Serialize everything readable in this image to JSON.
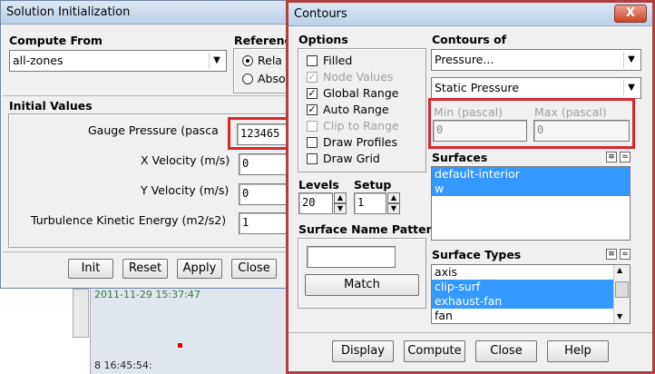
{
  "background": {
    "timestamp1": "2011-11-29 15:37:47",
    "timestamp2": "8 16:45:54:"
  },
  "solution_init": {
    "title": "Solution Initialization",
    "compute_from_label": "Compute From",
    "compute_from_value": "all-zones",
    "reference_label": "Referenc",
    "radio_relative": "Rela",
    "radio_absolute": "Abso",
    "initial_values_label": "Initial Values",
    "fields": [
      {
        "label": "Gauge Pressure (pasca",
        "value": "123465"
      },
      {
        "label": "X Velocity (m/s)",
        "value": "0"
      },
      {
        "label": "Y Velocity (m/s)",
        "value": "0"
      },
      {
        "label": "Turbulence Kinetic Energy (m2/s2)",
        "value": "1"
      }
    ],
    "buttons": {
      "init": "Init",
      "reset": "Reset",
      "apply": "Apply",
      "close": "Close"
    }
  },
  "contours": {
    "title": "Contours",
    "close_symbol": "X",
    "options_label": "Options",
    "options": [
      {
        "label": "Filled",
        "checked": false,
        "disabled": false
      },
      {
        "label": "Node Values",
        "checked": true,
        "disabled": true
      },
      {
        "label": "Global Range",
        "checked": true,
        "disabled": false
      },
      {
        "label": "Auto Range",
        "checked": true,
        "disabled": false
      },
      {
        "label": "Clip to Range",
        "checked": false,
        "disabled": true
      },
      {
        "label": "Draw Profiles",
        "checked": false,
        "disabled": false
      },
      {
        "label": "Draw Grid",
        "checked": false,
        "disabled": false
      }
    ],
    "check_mark": "✓",
    "levels_label": "Levels",
    "levels_value": "20",
    "setup_label": "Setup",
    "setup_value": "1",
    "surface_name_pattern_label": "Surface Name Pattern",
    "surface_name_pattern_value": "",
    "match_label": "Match",
    "contours_of_label": "Contours of",
    "contours_of_value": "Pressure...",
    "contours_sub_value": "Static Pressure",
    "min_label": "Min (pascal)",
    "min_value": "0",
    "max_label": "Max (pascal)",
    "max_value": "0",
    "surfaces_label": "Surfaces",
    "surfaces": [
      {
        "label": "default-interior",
        "selected": true
      },
      {
        "label": "w",
        "selected": true
      }
    ],
    "surface_types_label": "Surface Types",
    "surface_types": [
      {
        "label": "axis",
        "selected": false
      },
      {
        "label": "clip-surf",
        "selected": true
      },
      {
        "label": "exhaust-fan",
        "selected": true
      },
      {
        "label": "fan",
        "selected": false
      }
    ],
    "buttons": {
      "display": "Display",
      "compute": "Compute",
      "close": "Close",
      "help": "Help"
    }
  },
  "colors": {
    "highlight": "#d8262c",
    "selection": "#3399ff"
  }
}
